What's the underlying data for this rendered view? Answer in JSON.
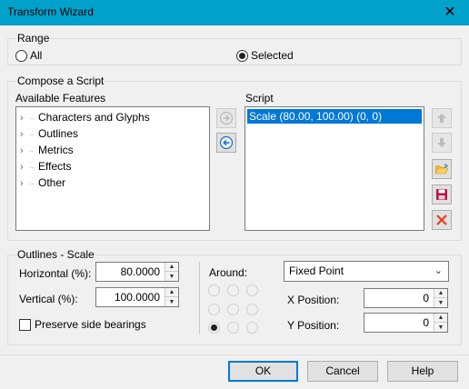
{
  "window": {
    "title": "Transform Wizard",
    "close_glyph": "✕"
  },
  "range": {
    "label": "Range",
    "options": [
      {
        "label": "All",
        "selected": false
      },
      {
        "label": "Selected",
        "selected": true
      }
    ]
  },
  "compose": {
    "label": "Compose a Script",
    "available_label": "Available Features",
    "features": [
      "Characters and Glyphs",
      "Outlines",
      "Metrics",
      "Effects",
      "Other"
    ],
    "script_label": "Script",
    "script_items": [
      "Scale (80.00, 100.00) (0, 0)"
    ],
    "tool_icons": [
      "move-up-icon",
      "move-down-icon",
      "open-folder-icon",
      "save-icon",
      "delete-icon"
    ],
    "add_icon": "arrow-right-icon",
    "remove_icon": "arrow-left-icon"
  },
  "outlines_scale": {
    "label": "Outlines - Scale",
    "horizontal_label": "Horizontal (%):",
    "horizontal_value": "80.0000",
    "vertical_label": "Vertical (%):",
    "vertical_value": "100.0000",
    "preserve_label": "Preserve side bearings",
    "preserve_checked": false,
    "around_label": "Around:",
    "around_value": "Fixed Point",
    "x_label": "X Position:",
    "x_value": "0",
    "y_label": "Y Position:",
    "y_value": "0",
    "anchor_selected_index": 6
  },
  "buttons": {
    "ok": "OK",
    "cancel": "Cancel",
    "help": "Help"
  },
  "colors": {
    "titlebar": "#00a2cc",
    "selection": "#0078d7",
    "delete": "#e2401c",
    "save": "#b3124c",
    "arrow_blue": "#1a6fc4"
  }
}
